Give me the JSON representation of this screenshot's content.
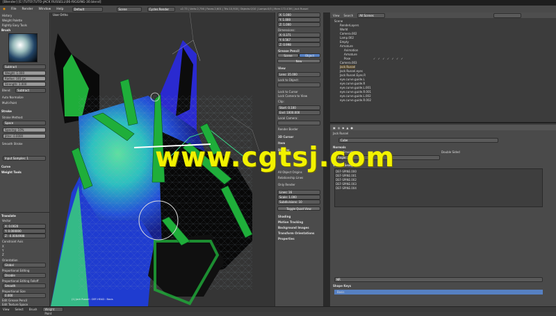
{
  "window_title": "[Blender] [E:\\TUTO\\TUTO-JACK RUSSELL\\06-RIGGING-30.blend]",
  "menu": [
    "File",
    "Render",
    "Window",
    "Help"
  ],
  "header": {
    "mode_field": "Default",
    "scene_field": "Scene",
    "engine": "Cycles Render",
    "info": "v2.73 | Verts:2,756 | Faces:2,601 | Tris:10,918 | Objects:0/10 | Lamps:0/0 | Mem:172.43M | Jack Russel"
  },
  "left_panel": {
    "tab_history": "History",
    "tab_weight_palette": "Weight Palette",
    "tab_rightly": "Rightly Easy Tools",
    "brush_label": "Brush",
    "brush_name": "Subtract",
    "weight": "Weight: 1.000",
    "radius": "Radius: 101 px",
    "strength": "Strength: 1.000",
    "blend": "Blend:",
    "blend_value": "Subtract",
    "auto_normalize": "Auto Normalize",
    "multi_paint": "Multi-Paint",
    "stroke": "Stroke",
    "stroke_method": "Stroke Method:",
    "stroke_value": "Space",
    "spacing": "Spacing: 10%",
    "jitter": "Jitter: 0.0000",
    "smooth_stroke": "Smooth Stroke",
    "input_samples": "Input Samples: 1",
    "curve": "Curve",
    "weight_tools": "Weight Tools",
    "translate": "Translate",
    "vector": "Vector",
    "x": "X: 0.0020",
    "y": "Y: 0.000000",
    "z": "Z: -0.0004988",
    "constraint_axis": "Constraint Axis",
    "axis_x": "X",
    "axis_y": "Y",
    "axis_z": "Z",
    "orientation": "Orientation",
    "orientation_value": "Global",
    "proportional_editing": "Proportional Editing",
    "prop_value": "Disable",
    "prop_falloff": "Proportional Editing Falloff",
    "falloff_value": "Smooth",
    "prop_size": "Proportional Size",
    "prop_size_value": "0.000",
    "edit_grease": "Edit Grease Pencil",
    "edit_texture": "Edit Texture Space",
    "confirm_release": "Confirm on Release"
  },
  "viewport": {
    "label": "User Ortho",
    "bottom_label": "(1) Jack Russel : DEF-HEAD : Basis"
  },
  "n_panel": {
    "loc_x": "X: 1.000",
    "loc_y": "Y: 1.000",
    "loc_z": "Z: 1.000",
    "dimensions": "Dimensions:",
    "dim_x": "X: 0.371",
    "dim_y": "Y: 0.567",
    "dim_z": "Z: 0.998",
    "grease_pencil": "Grease Pencil",
    "scene_btn": "Scene",
    "object_btn": "Object",
    "new_btn": "New",
    "view": "View",
    "lens": "Lens: 35.000",
    "lock_to_object": "Lock to Object:",
    "lock_to_cursor": "Lock to Cursor",
    "lock_camera": "Lock Camera to View",
    "clip": "Clip:",
    "start": "Start: 0.100",
    "end": "End: 1000.000",
    "local_camera": "Local Camera:",
    "render_border": "Render Border",
    "cursor_3d": "3D Cursor",
    "item": "Item",
    "display": "Display",
    "lines": "Lines: 16",
    "scale": "Scale: 1.000",
    "subdivisions": "Subdivisions: 10",
    "toggle_quad": "Toggle Quad View",
    "shading": "Shading",
    "motion_tracking": "Motion Tracking",
    "background_images": "Background Images",
    "transform_orientations": "Transform Orientations",
    "properties": "Properties",
    "all_object_origins": "All Object Origins",
    "relationship_lines": "Relationship Lines",
    "only_render": "Only Render"
  },
  "outliner": {
    "view": "View",
    "search": "Search",
    "scenes": "All Scenes",
    "items": [
      "Scene",
      "RenderLayers",
      "World",
      "Camera.002",
      "Lamp.002",
      "Empty",
      "Armature",
      "Animation",
      "Armature",
      "Pose",
      "Camera.003",
      "Jack Russel",
      "Jack Russel.eyes",
      "Jack Russel.Eyes.R",
      "eye.curve.guide.L",
      "eye.curve.guide.R",
      "eye.curve.guide.L.001",
      "eye.curve.guide.R.001",
      "eye.curve.guide.L.002",
      "eye.curve.guide.R.002"
    ]
  },
  "properties": {
    "context_object": "Jack Russel",
    "mesh_name": "Cube",
    "normals": "Normals",
    "auto_smooth": "Auto Smooth",
    "double_sided": "Double Sided",
    "angle": "Angle: 30°",
    "vertex_groups": "Vertex Groups",
    "groups": [
      "DEF-SPINE.000",
      "DEF-SPINE.001",
      "DEF-SPINE.002",
      "DEF-SPINE.003",
      "DEF-SPINE.004"
    ],
    "shape_keys": "Shape Keys",
    "shape_basis": "Basis",
    "name_field": "NR"
  },
  "statusbar": {
    "view": "View",
    "select": "Select",
    "brush": "Brush",
    "mode": "Weight Paint"
  },
  "watermark": "www.cgtsj.com",
  "colors": {
    "accent": "#5680c2",
    "watermark": "#f2f200",
    "bone_green": "#1fae3a"
  }
}
